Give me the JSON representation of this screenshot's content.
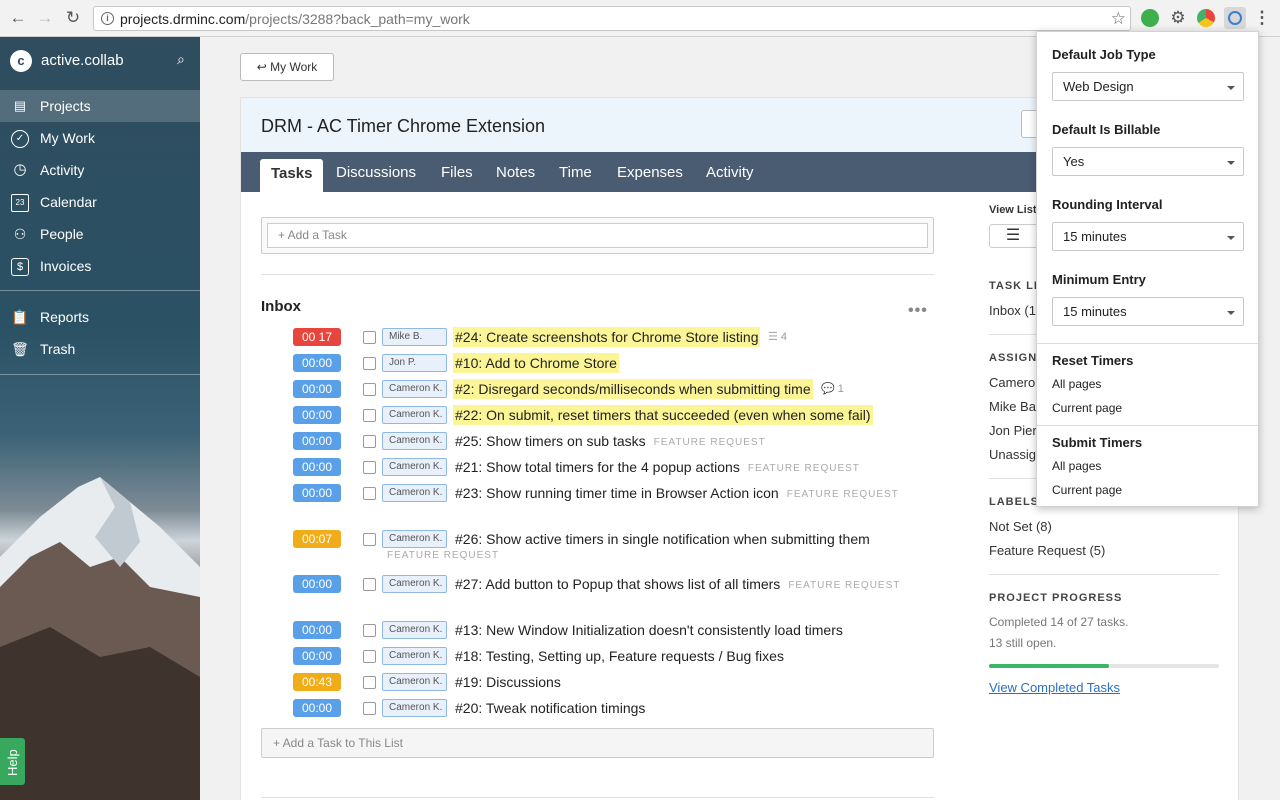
{
  "browser": {
    "url_host": "projects.drminc.com",
    "url_path": "/projects/3288?back_path=my_work"
  },
  "sidebar": {
    "brand": "active.collab",
    "items": [
      {
        "label": "Projects",
        "icon": "archive-icon"
      },
      {
        "label": "My Work",
        "icon": "check-circle-icon"
      },
      {
        "label": "Activity",
        "icon": "clock-icon"
      },
      {
        "label": "Calendar",
        "icon": "calendar-icon",
        "icon_text": "23"
      },
      {
        "label": "People",
        "icon": "person-icon"
      },
      {
        "label": "Invoices",
        "icon": "dollar-icon"
      },
      {
        "label": "Reports",
        "icon": "clipboard-icon"
      },
      {
        "label": "Trash",
        "icon": "trash-icon"
      }
    ],
    "help": "Help"
  },
  "main": {
    "back_label": "My Work",
    "project_title": "DRM - AC Timer Chrome Extension",
    "tabs": [
      "Tasks",
      "Discussions",
      "Files",
      "Notes",
      "Time",
      "Expenses",
      "Activity"
    ],
    "add_task_placeholder": "+ Add a Task",
    "list_title": "Inbox",
    "tasks": [
      {
        "timer": "00 17",
        "timer_color": "#e8453c",
        "assignee": "Mike B.",
        "name": "#24: Create screenshots for Chrome Store listing",
        "highlight": true,
        "meta": "4",
        "meta_icon": "subtasks-icon",
        "tag": ""
      },
      {
        "timer": "00:00",
        "timer_color": "#5aa0e8",
        "assignee": "Jon P.",
        "name": "#10: Add to Chrome Store",
        "highlight": true,
        "meta": "",
        "tag": ""
      },
      {
        "timer": "00:00",
        "timer_color": "#5aa0e8",
        "assignee": "Cameron K.",
        "name": "#2: Disregard seconds/milliseconds when submitting time",
        "highlight": true,
        "meta": "1",
        "meta_icon": "comment-icon",
        "tag": ""
      },
      {
        "timer": "00:00",
        "timer_color": "#5aa0e8",
        "assignee": "Cameron K.",
        "name": "#22: On submit, reset timers that succeeded (even when some fail)",
        "highlight": true,
        "meta": "",
        "tag": ""
      },
      {
        "timer": "00:00",
        "timer_color": "#5aa0e8",
        "assignee": "Cameron K.",
        "name": "#25: Show timers on sub tasks",
        "highlight": false,
        "meta": "",
        "tag": "FEATURE REQUEST"
      },
      {
        "timer": "00:00",
        "timer_color": "#5aa0e8",
        "assignee": "Cameron K.",
        "name": "#21: Show total timers for the 4 popup actions",
        "highlight": false,
        "meta": "",
        "tag": "FEATURE REQUEST"
      },
      {
        "timer": "00:00",
        "timer_color": "#5aa0e8",
        "assignee": "Cameron K.",
        "name": "#23: Show running timer time in Browser Action icon",
        "highlight": false,
        "meta": "",
        "tag": "FEATURE REQUEST"
      },
      {
        "timer": "00:07",
        "timer_color": "#f0ac19",
        "assignee": "Cameron K.",
        "name": "#26: Show active timers in single notification when submitting them",
        "highlight": false,
        "meta": "",
        "tag": "",
        "tag_below": "FEATURE REQUEST"
      },
      {
        "timer": "00:00",
        "timer_color": "#5aa0e8",
        "assignee": "Cameron K.",
        "name": "#27: Add button to Popup that shows list of all timers",
        "highlight": false,
        "meta": "",
        "tag": "FEATURE REQUEST"
      },
      {
        "timer": "00:00",
        "timer_color": "#5aa0e8",
        "assignee": "Cameron K.",
        "name": "#13: New Window Initialization doesn't consistently load timers",
        "highlight": false,
        "meta": "",
        "tag": ""
      },
      {
        "timer": "00:00",
        "timer_color": "#5aa0e8",
        "assignee": "Cameron K.",
        "name": "#18: Testing, Setting up, Feature requests / Bug fixes",
        "highlight": false,
        "meta": "",
        "tag": ""
      },
      {
        "timer": "00:43",
        "timer_color": "#f0ac19",
        "assignee": "Cameron K.",
        "name": "#19: Discussions",
        "highlight": false,
        "meta": "",
        "tag": ""
      },
      {
        "timer": "00:00",
        "timer_color": "#5aa0e8",
        "assignee": "Cameron K.",
        "name": "#20: Tweak notification timings",
        "highlight": false,
        "meta": "",
        "tag": ""
      }
    ],
    "add_to_list_placeholder": "+ Add a Task to This List"
  },
  "right_panel": {
    "view_label": "View List,",
    "task_lists_heading": "TASK LI",
    "task_lists_value": "Inbox (1",
    "assignees_heading": "ASSIGN",
    "assignees": [
      "Camero",
      "Mike Bal",
      "Jon Pier",
      "Unassig"
    ],
    "labels_heading": "LABELS",
    "labels": [
      "Not Set (8)",
      "Feature Request (5)"
    ],
    "progress_heading": "PROJECT PROGRESS",
    "progress_line1": "Completed 14 of 27 tasks.",
    "progress_line2": "13 still open.",
    "progress_fraction": 0.52,
    "view_completed": "View Completed Tasks"
  },
  "popup": {
    "default_job_type_label": "Default Job Type",
    "default_job_type_value": "Web Design",
    "default_billable_label": "Default Is Billable",
    "default_billable_value": "Yes",
    "rounding_label": "Rounding Interval",
    "rounding_value": "15 minutes",
    "minimum_label": "Minimum Entry",
    "minimum_value": "15 minutes",
    "reset_heading": "Reset Timers",
    "reset_all": "All pages",
    "reset_current": "Current page",
    "submit_heading": "Submit Timers",
    "submit_all": "All pages",
    "submit_current": "Current page"
  }
}
